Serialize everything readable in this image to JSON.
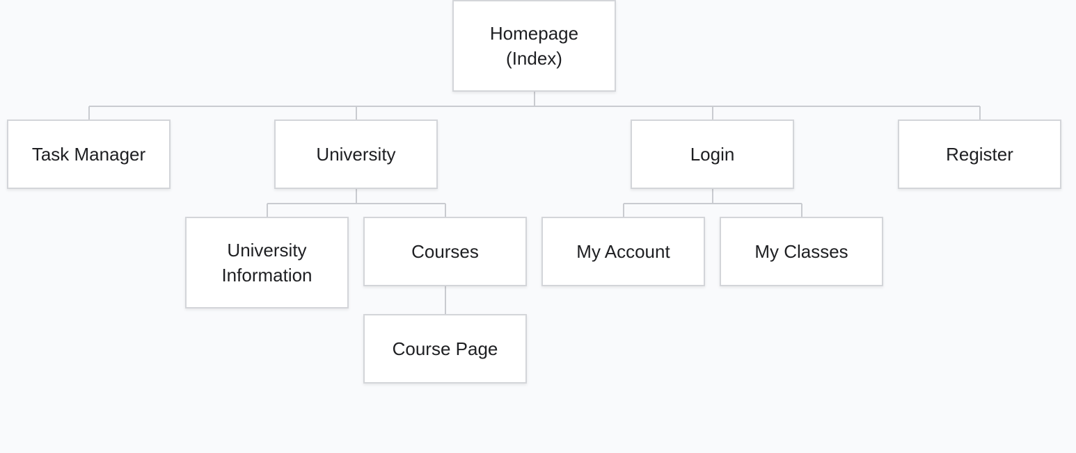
{
  "sitemap": {
    "homepage": "Homepage\n(Index)",
    "task_manager": "Task Manager",
    "university": "University",
    "login": "Login",
    "register": "Register",
    "university_information": "University\nInformation",
    "courses": "Courses",
    "my_account": "My Account",
    "my_classes": "My Classes",
    "course_page": "Course Page"
  },
  "colors": {
    "background": "#f9fafc",
    "node_fill": "#ffffff",
    "node_border": "#d3d5d9",
    "connector": "#c9cbd0",
    "text": "#1e1f22"
  }
}
